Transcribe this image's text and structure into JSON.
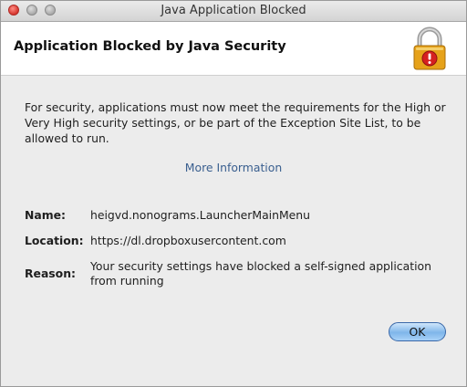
{
  "window": {
    "title": "Java Application Blocked"
  },
  "header": {
    "title": "Application Blocked by Java Security"
  },
  "message": "For security, applications must now meet the requirements for the High or Very High security settings, or be part of the Exception Site List, to be allowed to run.",
  "more_info": "More Information",
  "details": {
    "name_label": "Name:",
    "name_value": "heigvd.nonograms.LauncherMainMenu",
    "location_label": "Location:",
    "location_value": "https://dl.dropboxusercontent.com",
    "reason_label": "Reason:",
    "reason_value": "Your security settings have blocked a self-signed application from running"
  },
  "buttons": {
    "ok": "OK"
  },
  "icons": {
    "lock": "padlock-warning-icon"
  },
  "colors": {
    "link": "#3a5f8f",
    "ok_button": "#7fb6ea",
    "warning": "#d62020"
  }
}
